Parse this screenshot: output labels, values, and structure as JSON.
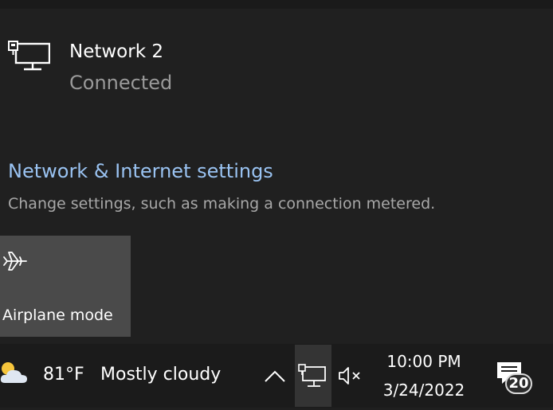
{
  "network": {
    "name": "Network 2",
    "status": "Connected"
  },
  "settings": {
    "link_label": "Network & Internet settings",
    "description": "Change settings, such as making a connection metered."
  },
  "quick_actions": {
    "airplane_label": "Airplane mode"
  },
  "taskbar": {
    "weather_temp": "81°F",
    "weather_desc": "Mostly cloudy",
    "time": "10:00 PM",
    "date": "3/24/2022",
    "notification_count": "20"
  },
  "icons": {
    "network": "wired-network-icon",
    "airplane": "airplane-icon",
    "weather": "partly-cloudy-icon",
    "chevron": "chevron-up-icon",
    "volume": "volume-muted-icon",
    "notifications": "notification-icon"
  },
  "colors": {
    "link": "#9ac3f2",
    "tile_bg": "#4a4a4a",
    "flyout_bg": "#202020",
    "taskbar_bg": "#1b1b1b"
  }
}
